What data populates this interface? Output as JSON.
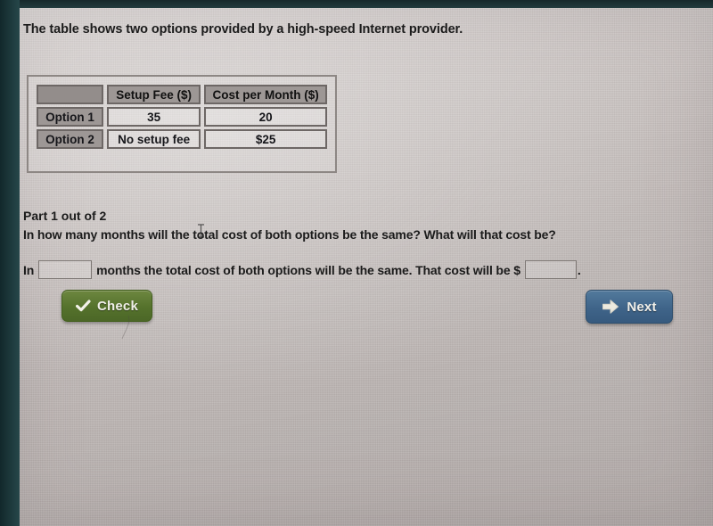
{
  "prompt": "The table shows two options provided by a high-speed Internet provider.",
  "table": {
    "corner_blank": "",
    "headers": [
      "Setup Fee ($)",
      "Cost per Month ($)"
    ],
    "rows": [
      {
        "label": "Option 1",
        "setup_fee": "35",
        "cost_per_month": "20"
      },
      {
        "label": "Option 2",
        "setup_fee": "No setup fee",
        "cost_per_month": "$25"
      }
    ]
  },
  "question": {
    "part_label": "Part 1 out of 2",
    "text": "In how many months will the total cost of both options be the same? What will that cost be?"
  },
  "answer": {
    "prefix": "In",
    "middle": "months the total cost of both options will be the same. That cost will be $",
    "suffix": ".",
    "months_value": "",
    "months_placeholder": "",
    "cost_value": "",
    "cost_placeholder": ""
  },
  "buttons": {
    "check": {
      "label": "Check",
      "icon": "checkmark-icon",
      "color": "#55722c"
    },
    "next": {
      "label": "Next",
      "icon": "right-arrow-icon",
      "color": "#3f6489"
    }
  },
  "colors": {
    "page_background": "#c9c2c0",
    "bezel": "#21403f",
    "table_border": "#6d6765",
    "table_header_fill": "#9d9795",
    "text": "#1b1b1b"
  }
}
